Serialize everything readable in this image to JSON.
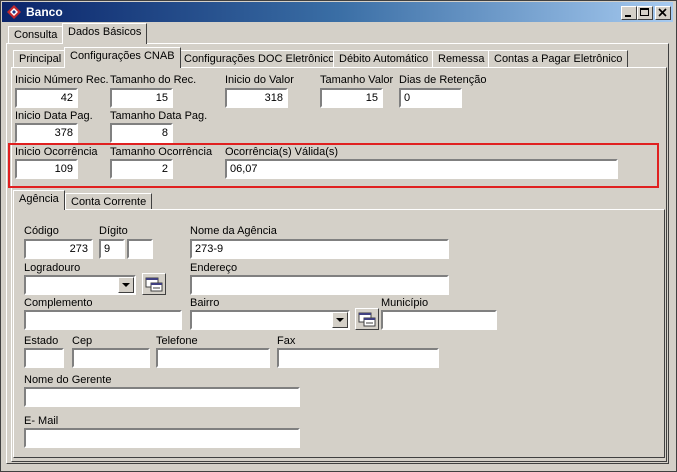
{
  "window": {
    "title": "Banco"
  },
  "top_tabs": [
    "Consulta",
    "Dados Básicos"
  ],
  "sub_tabs": [
    "Principal",
    "Configurações CNAB",
    "Configurações DOC Eletrônico",
    "Débito Automático",
    "Remessa",
    "Contas a Pagar Eletrônico"
  ],
  "cnab": {
    "inicio_numero_rec": {
      "label": "Inicio Número Rec.",
      "value": "42"
    },
    "tamanho_rec": {
      "label": "Tamanho do Rec.",
      "value": "15"
    },
    "inicio_valor": {
      "label": "Inicio do Valor",
      "value": "318"
    },
    "tamanho_valor": {
      "label": "Tamanho Valor",
      "value": "15"
    },
    "dias_retencao": {
      "label": "Dias de Retenção",
      "value": "0"
    },
    "inicio_data_pag": {
      "label": "Inicio Data Pag.",
      "value": "378"
    },
    "tamanho_data_pag": {
      "label": "Tamanho Data Pag.",
      "value": "8"
    },
    "inicio_ocorrencia": {
      "label": "Inicio Ocorrência",
      "value": "109"
    },
    "tamanho_ocorrencia": {
      "label": "Tamanho Ocorrência",
      "value": "2"
    },
    "ocorrencias_validas": {
      "label": "Ocorrência(s) Válida(s)",
      "value": "06,07"
    }
  },
  "inner_tabs": [
    "Agência",
    "Conta Corrente"
  ],
  "agencia": {
    "codigo": {
      "label": "Código",
      "value": "273"
    },
    "digito": {
      "label": "Dígito",
      "value": "9",
      "value2": ""
    },
    "nome_agencia": {
      "label": "Nome da Agência",
      "value": "273-9"
    },
    "logradouro": {
      "label": "Logradouro",
      "value": ""
    },
    "endereco": {
      "label": "Endereço",
      "value": ""
    },
    "complemento": {
      "label": "Complemento",
      "value": ""
    },
    "bairro": {
      "label": "Bairro",
      "value": ""
    },
    "municipio": {
      "label": "Município",
      "value": ""
    },
    "estado": {
      "label": "Estado",
      "value": ""
    },
    "cep": {
      "label": "Cep",
      "value": ""
    },
    "telefone": {
      "label": "Telefone",
      "value": ""
    },
    "fax": {
      "label": "Fax",
      "value": ""
    },
    "nome_gerente": {
      "label": "Nome do Gerente",
      "value": ""
    },
    "email": {
      "label": "E- Mail",
      "value": ""
    }
  }
}
